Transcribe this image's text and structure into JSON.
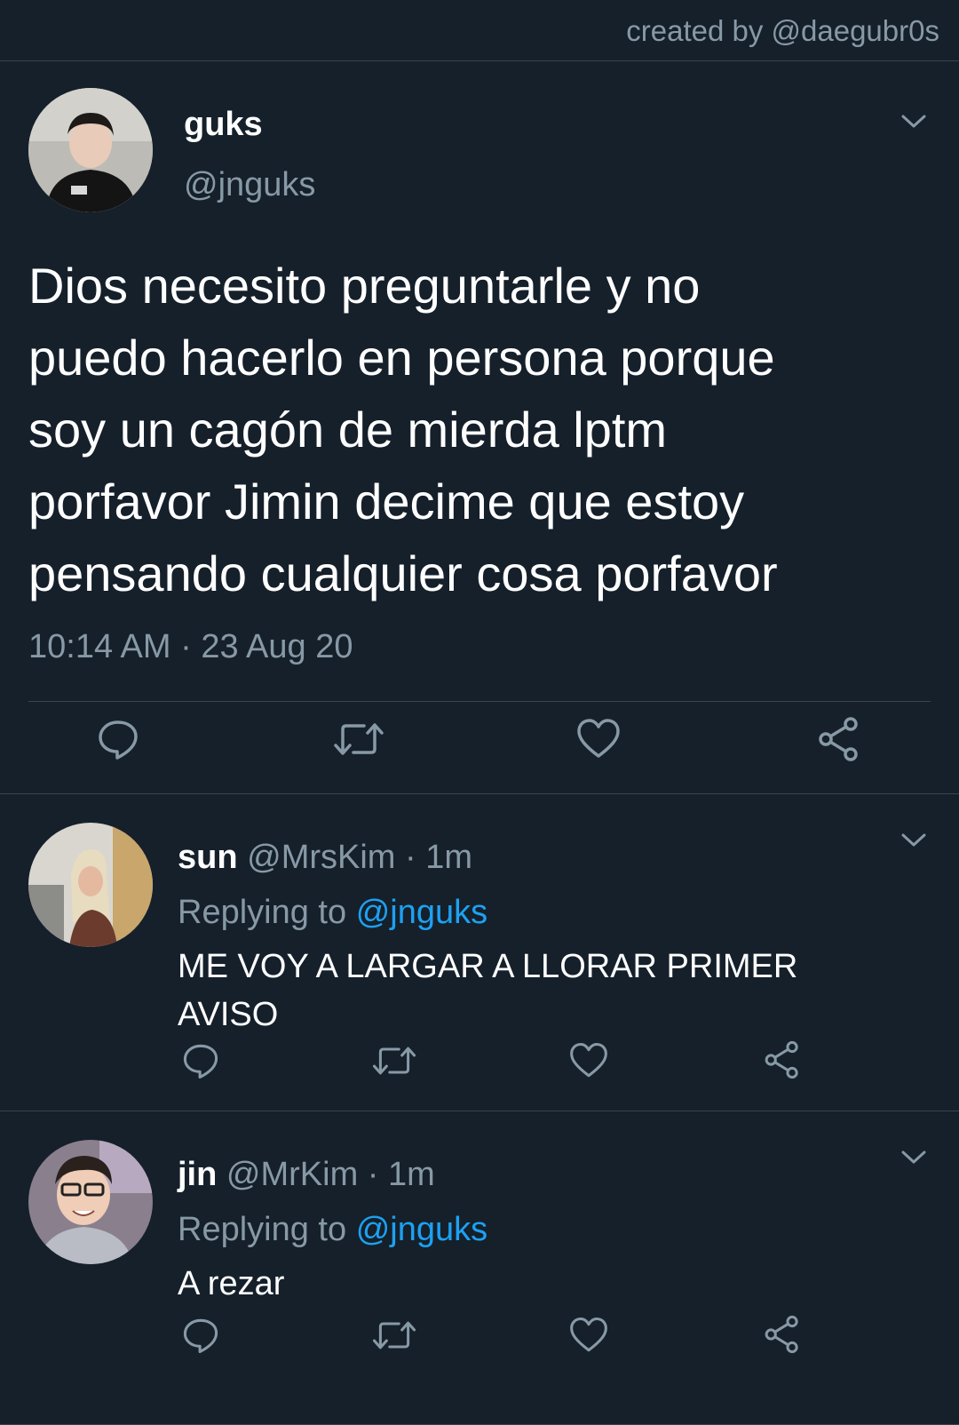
{
  "credit": "created by @daegubr0s",
  "main_tweet": {
    "name": "guks",
    "handle": "@jnguks",
    "text": "Dios necesito preguntarle y no\npuedo hacerlo en persona porque\nsoy un cagón de mierda lptm\nporfavor Jimin decime que estoy\npensando cualquier cosa porfavor",
    "timestamp": "10:14 AM · 23 Aug 20",
    "actions": [
      "reply-icon",
      "retweet-icon",
      "like-icon",
      "share-icon"
    ]
  },
  "replies": [
    {
      "name": "sun",
      "handle": "@MrsKim",
      "time": "· 1m",
      "replying_prefix": "Replying to",
      "replying_to": "@jnguks",
      "text": "ME VOY A LARGAR A LLORAR PRIMER AVISO"
    },
    {
      "name": "jin",
      "handle": "@MrKim",
      "time": "· 1m",
      "replying_prefix": "Replying to",
      "replying_to": "@jnguks",
      "text": "A rezar"
    }
  ],
  "colors": {
    "background": "#15202b",
    "secondary_text": "#8899a6",
    "link": "#1da1f2",
    "divider": "#38444d"
  }
}
